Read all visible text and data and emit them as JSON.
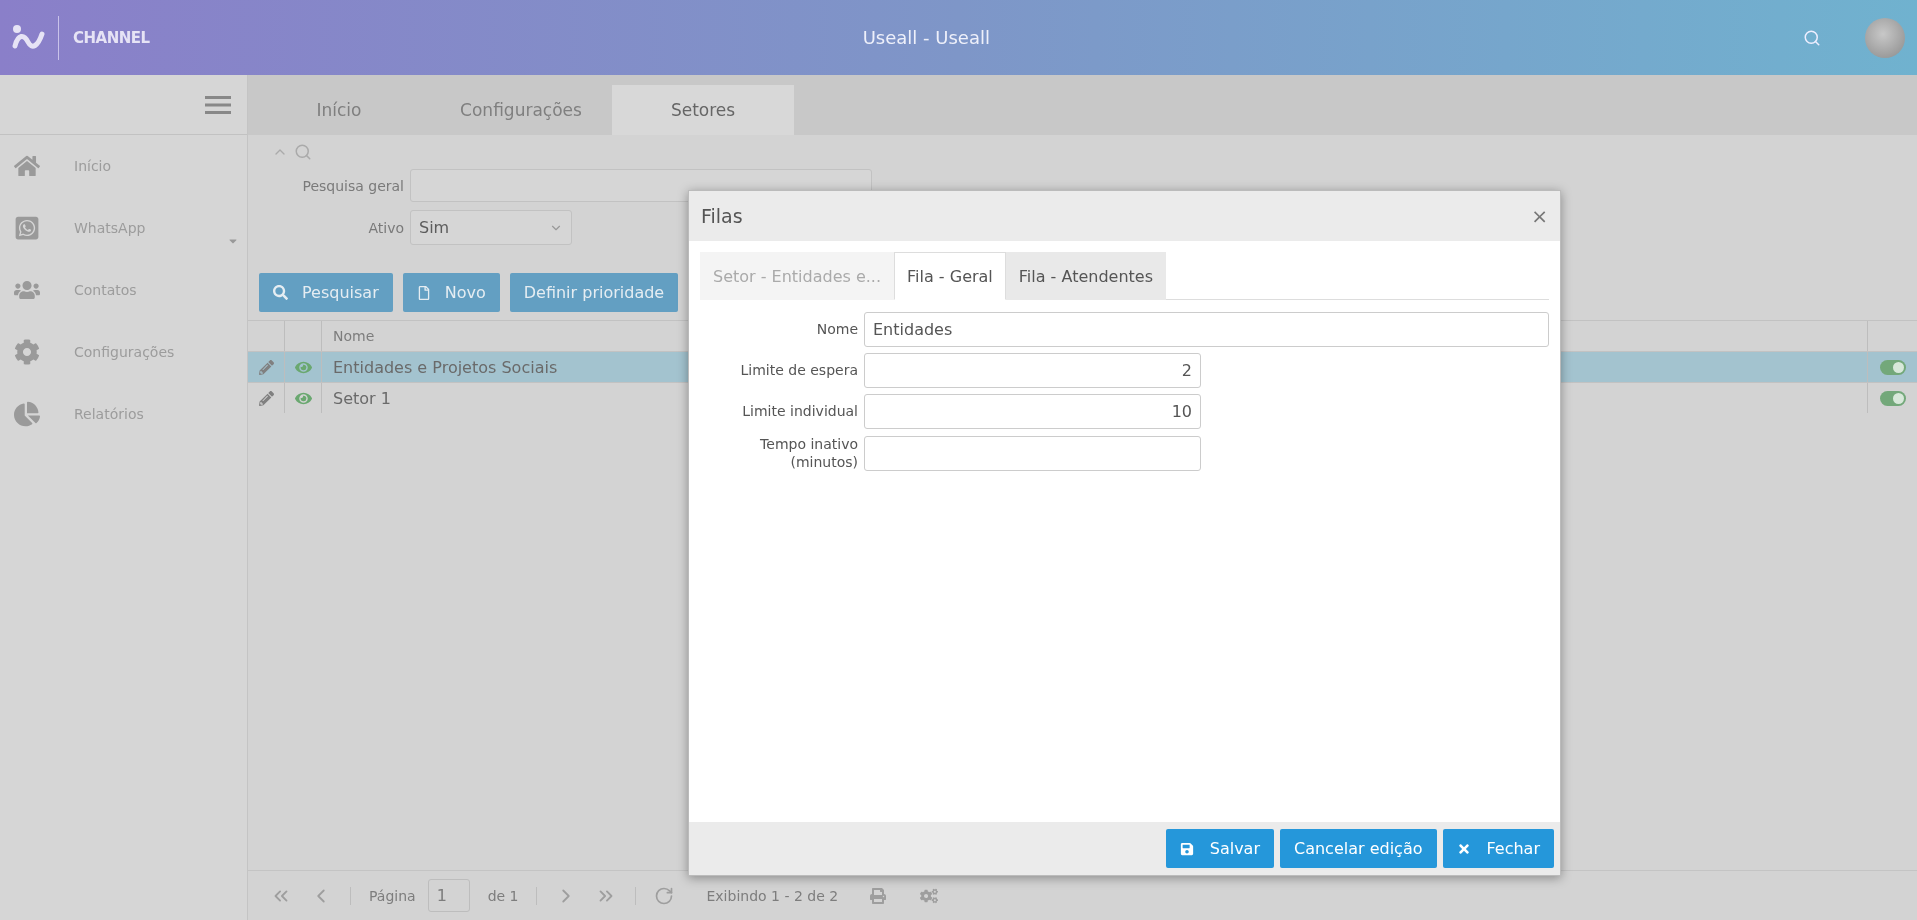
{
  "header": {
    "logo_text": "CHANNEL",
    "title": "Useall - Useall"
  },
  "sidebar": {
    "items": [
      {
        "kind": "home",
        "label": "Início",
        "expandable": false
      },
      {
        "kind": "whatsapp",
        "label": "WhatsApp",
        "expandable": true
      },
      {
        "kind": "contacts",
        "label": "Contatos",
        "expandable": false
      },
      {
        "kind": "settings",
        "label": "Configurações",
        "expandable": false
      },
      {
        "kind": "reports",
        "label": "Relatórios",
        "expandable": false
      }
    ]
  },
  "tabs": [
    {
      "label": "Início",
      "selected": false
    },
    {
      "label": "Configurações",
      "selected": false
    },
    {
      "label": "Setores",
      "selected": true
    }
  ],
  "filters": {
    "general_search": {
      "label": "Pesquisa geral"
    },
    "active": {
      "label": "Ativo",
      "value": "Sim"
    }
  },
  "actions": [
    {
      "kind": "search",
      "label": "Pesquisar"
    },
    {
      "kind": "new",
      "label": "Novo"
    },
    {
      "kind": "plain",
      "label": "Definir prioridade"
    }
  ],
  "table": {
    "columns": [
      "Nome"
    ],
    "rows": [
      {
        "name": "Entidades e Projetos Sociais",
        "selected": true,
        "on": true
      },
      {
        "name": "Setor 1",
        "selected": false,
        "on": true
      }
    ]
  },
  "pager": {
    "page_label": "Página",
    "page": "1",
    "of": "de 1",
    "summary": "Exibindo 1 - 2 de 2"
  },
  "dialog": {
    "title": "Filas",
    "close": "×",
    "tabs": [
      {
        "label": "Setor - Entidades e...",
        "selected": false,
        "disabled": true
      },
      {
        "label": "Fila - Geral",
        "selected": true,
        "disabled": false
      },
      {
        "label": "Fila - Atendentes",
        "selected": false,
        "disabled": false
      }
    ],
    "fields": [
      {
        "label": "Nome",
        "value": "Entidades",
        "kind": "text"
      },
      {
        "label": "Limite de espera",
        "value": "2",
        "kind": "number"
      },
      {
        "label": "Limite individual",
        "value": "10",
        "kind": "number"
      },
      {
        "label": "Tempo inativo (minutos)",
        "kind": "number"
      }
    ],
    "buttons": [
      {
        "kind": "save",
        "label": "Salvar"
      },
      {
        "kind": "plain",
        "label": "Cancelar edição"
      },
      {
        "kind": "close",
        "label": "Fechar"
      }
    ]
  }
}
